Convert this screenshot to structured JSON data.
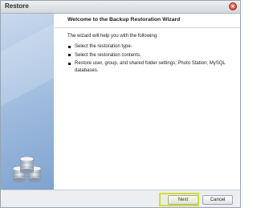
{
  "window": {
    "title": "Restore",
    "close_icon": "close-icon"
  },
  "sidebar": {
    "icon": "database-icon"
  },
  "content": {
    "heading": "Welcome to the Backup Restoration Wizard",
    "intro": "The wizard will help you with the following:",
    "items": [
      {
        "label": "Select the restoration type."
      },
      {
        "label": "Select the restoration contents."
      },
      {
        "label": "Restore user, group, and shared folder settings; Photo Station; MySQL databases."
      }
    ]
  },
  "footer": {
    "next_label": "Next",
    "cancel_label": "Cancel"
  },
  "colors": {
    "highlight": "#d6dc3a",
    "close": "#c8321a",
    "sidebar": "#a3bfe0"
  }
}
